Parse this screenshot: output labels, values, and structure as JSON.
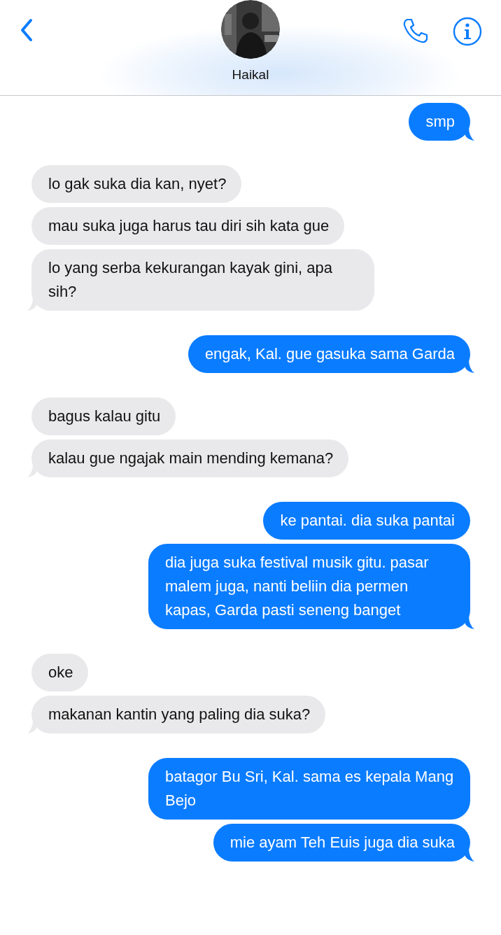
{
  "header": {
    "contact_name": "Haikal"
  },
  "messages": [
    {
      "kind": "sent",
      "text": "smp"
    },
    {
      "kind": "received",
      "text": "lo gak suka dia kan, nyet?"
    },
    {
      "kind": "received",
      "text": "mau suka juga harus tau diri sih kata gue"
    },
    {
      "kind": "received",
      "text": "lo yang serba kekurangan kayak gini, apa sih?"
    },
    {
      "kind": "sent",
      "text": "engak, Kal. gue gasuka sama Garda"
    },
    {
      "kind": "received",
      "text": "bagus kalau gitu"
    },
    {
      "kind": "received",
      "text": "kalau gue ngajak main mending kemana?"
    },
    {
      "kind": "sent",
      "text": "ke pantai. dia suka pantai"
    },
    {
      "kind": "sent",
      "text": "dia juga suka festival musik gitu. pasar malem juga, nanti beliin dia permen kapas, Garda pasti seneng banget"
    },
    {
      "kind": "received",
      "text": "oke"
    },
    {
      "kind": "received",
      "text": "makanan kantin yang paling dia suka?"
    },
    {
      "kind": "sent",
      "text": "batagor Bu Sri, Kal. sama es kepala Mang Bejo"
    },
    {
      "kind": "sent",
      "text": "mie ayam Teh Euis juga dia suka"
    }
  ]
}
